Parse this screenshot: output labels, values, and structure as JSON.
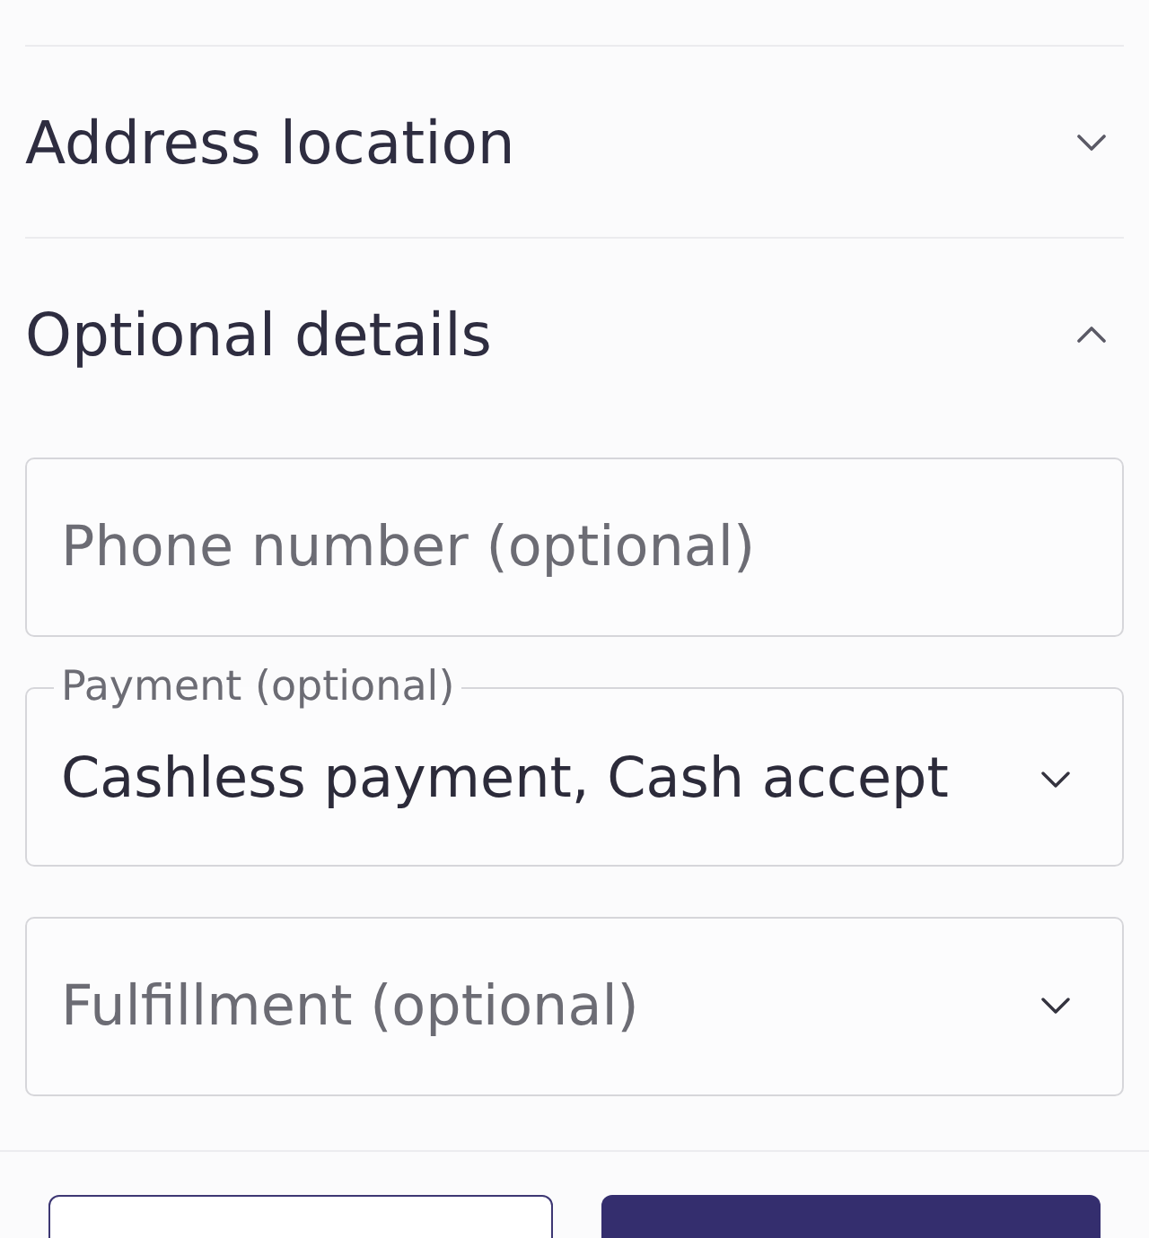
{
  "sections": [
    {
      "title": "Address location",
      "expanded": false
    },
    {
      "title": "Optional details",
      "expanded": true,
      "fields": [
        {
          "kind": "text",
          "placeholder": "Phone number (optional)"
        },
        {
          "kind": "select",
          "label": "Payment (optional)",
          "value": "Cashless payment, Cash accept"
        },
        {
          "kind": "select",
          "placeholder": "Fulfillment (optional)"
        }
      ]
    }
  ],
  "footer_buttons": [
    {
      "kind": "outline"
    },
    {
      "kind": "filled"
    }
  ]
}
